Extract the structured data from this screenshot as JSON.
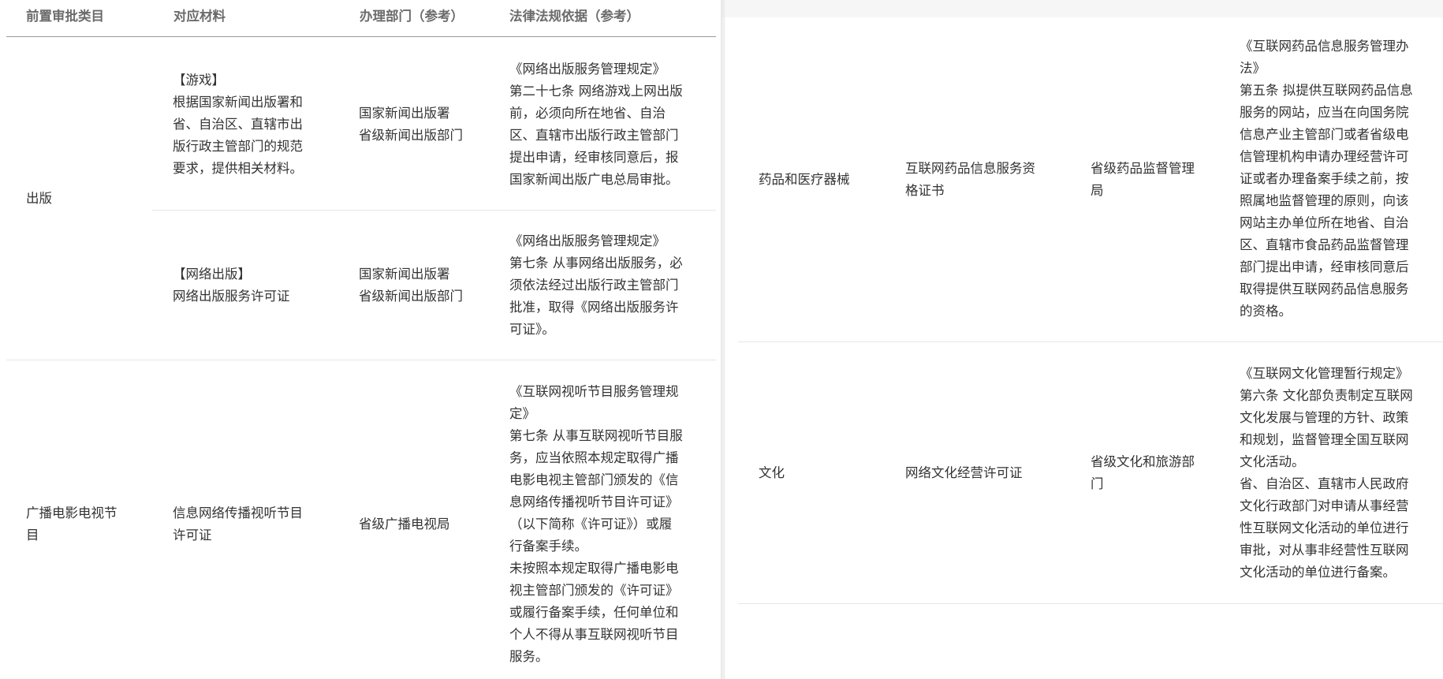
{
  "left_table": {
    "headers": [
      "前置审批类目",
      "对应材料",
      "办理部门（参考）",
      "法律法规依据（参考）"
    ],
    "rows": [
      {
        "category": "出版",
        "subrows": [
          {
            "material": "【游戏】\n根据国家新闻出版署和\n省、自治区、直辖市出\n版行政主管部门的规范\n要求，提供相关材料。",
            "department": "国家新闻出版署\n省级新闻出版部门",
            "basis": "《网络出版服务管理规定》\n第二十七条 网络游戏上网出版\n前，必须向所在地省、自治\n区、直辖市出版行政主管部门\n提出申请，经审核同意后，报\n国家新闻出版广电总局审批。"
          },
          {
            "material": "【网络出版】\n网络出版服务许可证",
            "department": "国家新闻出版署\n省级新闻出版部门",
            "basis": "《网络出版服务管理规定》\n第七条 从事网络出版服务，必\n须依法经过出版行政主管部门\n批准，取得《网络出版服务许\n可证》。"
          }
        ]
      },
      {
        "category": "广播电影电视节\n目",
        "material": "信息网络传播视听节目\n许可证",
        "department": "省级广播电视局",
        "basis": "《互联网视听节目服务管理规\n定》\n第七条 从事互联网视听节目服\n务，应当依照本规定取得广播\n电影电视主管部门颁发的《信\n息网络传播视听节目许可证》\n（以下简称《许可证》）或履\n行备案手续。\n未按照本规定取得广播电影电\n视主管部门颁发的《许可证》\n或履行备案手续，任何单位和\n个人不得从事互联网视听节目\n服务。"
      }
    ]
  },
  "right_table": {
    "rows": [
      {
        "category": "药品和医疗器械",
        "material": "互联网药品信息服务资\n格证书",
        "department": "省级药品监督管理\n局",
        "basis": "《互联网药品信息服务管理办\n法》\n第五条 拟提供互联网药品信息\n服务的网站，应当在向国务院\n信息产业主管部门或者省级电\n信管理机构申请办理经营许可\n证或者办理备案手续之前，按\n照属地监督管理的原则，向该\n网站主办单位所在地省、自治\n区、直辖市食品药品监督管理\n部门提出申请，经审核同意后\n取得提供互联网药品信息服务\n的资格。"
      },
      {
        "category": "文化",
        "material": "网络文化经营许可证",
        "department": "省级文化和旅游部\n门",
        "basis": "《互联网文化管理暂行规定》\n第六条 文化部负责制定互联网\n文化发展与管理的方针、政策\n和规划，监督管理全国互联网\n文化活动。\n省、自治区、直辖市人民政府\n文化行政部门对申请从事经营\n性互联网文化活动的单位进行\n审批，对从事非经营性互联网\n文化活动的单位进行备案。"
      }
    ]
  }
}
